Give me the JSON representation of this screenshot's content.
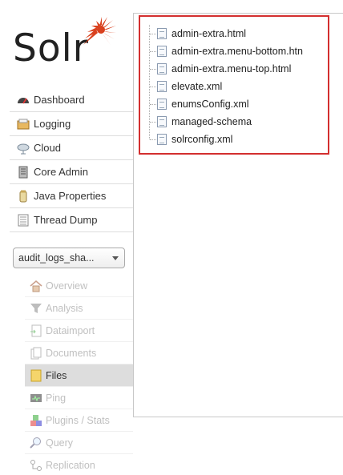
{
  "app": {
    "brand": "Solr"
  },
  "main_nav": [
    {
      "label": "Dashboard",
      "icon": "dashboard-icon"
    },
    {
      "label": "Logging",
      "icon": "logging-icon"
    },
    {
      "label": "Cloud",
      "icon": "cloud-icon"
    },
    {
      "label": "Core Admin",
      "icon": "core-admin-icon"
    },
    {
      "label": "Java Properties",
      "icon": "java-properties-icon"
    },
    {
      "label": "Thread Dump",
      "icon": "thread-dump-icon"
    }
  ],
  "core_selector": {
    "selected": "audit_logs_sha..."
  },
  "core_nav": [
    {
      "label": "Overview",
      "icon": "home-icon"
    },
    {
      "label": "Analysis",
      "icon": "funnel-icon"
    },
    {
      "label": "Dataimport",
      "icon": "dataimport-icon"
    },
    {
      "label": "Documents",
      "icon": "documents-icon"
    },
    {
      "label": "Files",
      "icon": "folder-icon",
      "active": true
    },
    {
      "label": "Ping",
      "icon": "ping-icon"
    },
    {
      "label": "Plugins / Stats",
      "icon": "plugins-icon"
    },
    {
      "label": "Query",
      "icon": "query-icon"
    },
    {
      "label": "Replication",
      "icon": "replication-icon"
    }
  ],
  "files": [
    "admin-extra.html",
    "admin-extra.menu-bottom.htn",
    "admin-extra.menu-top.html",
    "elevate.xml",
    "enumsConfig.xml",
    "managed-schema",
    "solrconfig.xml"
  ],
  "colors": {
    "logo_red": "#d9411e",
    "highlight_border": "#d32f2f",
    "active_bg": "#dddddd"
  }
}
